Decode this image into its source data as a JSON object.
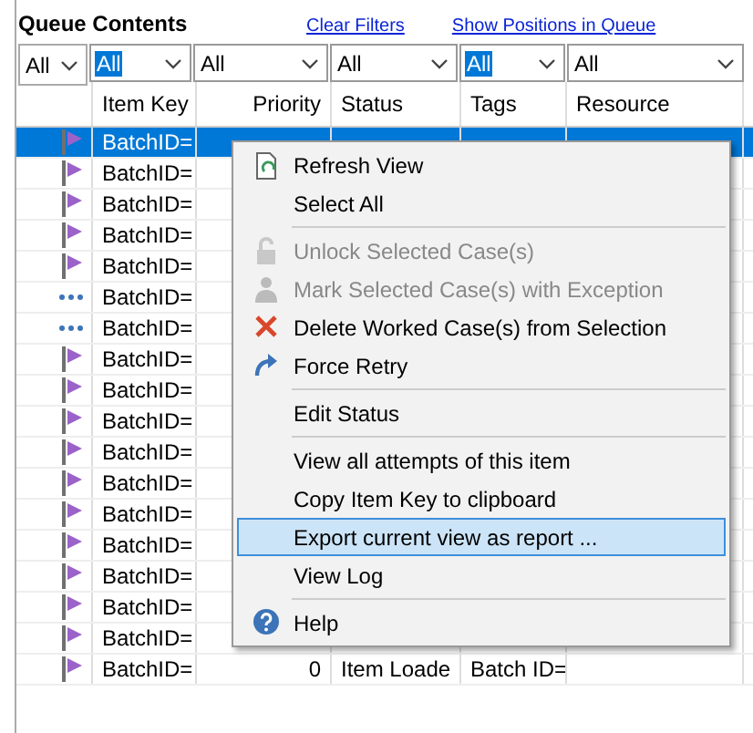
{
  "title": "Queue Contents",
  "links": [
    "Clear Filters",
    "Show Positions in Queue"
  ],
  "filters": [
    {
      "value": "All",
      "highlighted": false
    },
    {
      "value": "All",
      "highlighted": true
    },
    {
      "value": "All",
      "highlighted": false
    },
    {
      "value": "All",
      "highlighted": false
    },
    {
      "value": "All",
      "highlighted": true
    },
    {
      "value": "All",
      "highlighted": false
    }
  ],
  "table": {
    "columns": [
      "Item Key",
      "Priority",
      "Status",
      "Tags",
      "Resource"
    ],
    "rows": [
      {
        "kind": "flag",
        "item_key": "BatchID=",
        "selected": true
      },
      {
        "kind": "flag",
        "item_key": "BatchID=",
        "selected": false
      },
      {
        "kind": "flag",
        "item_key": "BatchID=",
        "selected": false
      },
      {
        "kind": "flag",
        "item_key": "BatchID=",
        "selected": false
      },
      {
        "kind": "flag",
        "item_key": "BatchID=",
        "selected": false
      },
      {
        "kind": "dots",
        "item_key": "BatchID=",
        "selected": false
      },
      {
        "kind": "dots",
        "item_key": "BatchID=",
        "selected": false
      },
      {
        "kind": "flag",
        "item_key": "BatchID=",
        "selected": false
      },
      {
        "kind": "flag",
        "item_key": "BatchID=",
        "selected": false
      },
      {
        "kind": "flag",
        "item_key": "BatchID=",
        "selected": false
      },
      {
        "kind": "flag",
        "item_key": "BatchID=",
        "selected": false
      },
      {
        "kind": "flag",
        "item_key": "BatchID=",
        "selected": false
      },
      {
        "kind": "flag",
        "item_key": "BatchID=",
        "selected": false
      },
      {
        "kind": "flag",
        "item_key": "BatchID=",
        "selected": false
      },
      {
        "kind": "flag",
        "item_key": "BatchID=",
        "selected": false
      },
      {
        "kind": "flag",
        "item_key": "BatchID=",
        "selected": false
      },
      {
        "kind": "flag",
        "item_key": "BatchID=",
        "selected": false
      },
      {
        "kind": "flag",
        "item_key": "BatchID=",
        "selected": false,
        "priority": "0",
        "status": "Item Loade",
        "tags": "Batch ID="
      }
    ]
  },
  "context_menu": [
    {
      "kind": "refresh",
      "label": "Refresh View",
      "disabled": false,
      "selected": false
    },
    {
      "kind": "plain",
      "label": "Select All",
      "disabled": false,
      "selected": false
    },
    {
      "kind": "separator"
    },
    {
      "kind": "lock",
      "label": "Unlock Selected Case(s)",
      "disabled": true,
      "selected": false
    },
    {
      "kind": "person",
      "label": "Mark Selected Case(s) with Exception",
      "disabled": true,
      "selected": false
    },
    {
      "kind": "delete",
      "label": "Delete Worked Case(s) from Selection",
      "disabled": false,
      "selected": false
    },
    {
      "kind": "retry",
      "label": "Force Retry",
      "disabled": false,
      "selected": false
    },
    {
      "kind": "separator"
    },
    {
      "kind": "plain",
      "label": "Edit Status",
      "disabled": false,
      "selected": false
    },
    {
      "kind": "separator"
    },
    {
      "kind": "plain",
      "label": "View all attempts of this item",
      "disabled": false,
      "selected": false
    },
    {
      "kind": "plain",
      "label": "Copy Item Key to clipboard",
      "disabled": false,
      "selected": false
    },
    {
      "kind": "plain",
      "label": "Export current view as report ...",
      "disabled": false,
      "selected": true
    },
    {
      "kind": "plain",
      "label": "View Log",
      "disabled": false,
      "selected": false
    },
    {
      "kind": "separator"
    },
    {
      "kind": "help",
      "label": "Help",
      "disabled": false,
      "selected": false
    }
  ]
}
